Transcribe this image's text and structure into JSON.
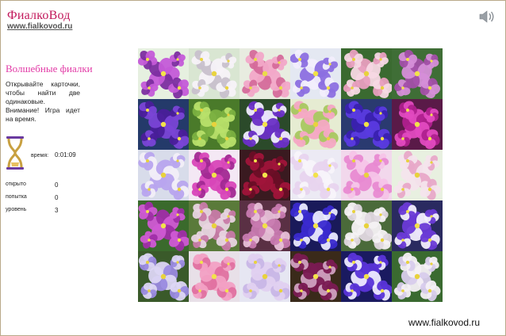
{
  "header": {
    "logo_text": "ФиалкоВод",
    "logo_url": "www.fialkovod.ru",
    "sound_icon": "speaker-icon"
  },
  "sidebar": {
    "title": "Волшебные фиалки",
    "desc_line1": "Открывайте карточки, чтобы найти две одинаковые.",
    "desc_line2": "Внимание! Игра идет на время.",
    "time_label": "время:",
    "time_value": "0:01:09",
    "stats": [
      {
        "label": "открыто",
        "value": "0"
      },
      {
        "label": "попытка",
        "value": "0"
      },
      {
        "label": "уровень",
        "value": "3"
      }
    ]
  },
  "board": {
    "rows": 5,
    "cols": 6,
    "cards": [
      {
        "bg": "#e6f0e0",
        "petal": "#c45ad8",
        "center": "#f4e44a",
        "dark": "#7c2da0"
      },
      {
        "bg": "#d9e6d2",
        "petal": "#f7f2f8",
        "center": "#e9d440",
        "dark": "#c8c0cc"
      },
      {
        "bg": "#e8ece0",
        "petal": "#f2a8c8",
        "center": "#eadc48",
        "dark": "#d56a9a"
      },
      {
        "bg": "#e4e8f2",
        "petal": "#8c6fe0",
        "center": "#f1e145",
        "dark": "#f2eefc"
      },
      {
        "bg": "#3a6a30",
        "petal": "#f7d8e4",
        "center": "#e8d23c",
        "dark": "#e89fbf"
      },
      {
        "bg": "#3f6e36",
        "petal": "#d58ed8",
        "center": "#f2e24a",
        "dark": "#a24fa8"
      },
      {
        "bg": "#243a6a",
        "petal": "#7a44d6",
        "center": "#f2e24a",
        "dark": "#4a1e9a"
      },
      {
        "bg": "#4a7a2a",
        "petal": "#b8e06a",
        "center": "#e8d23c",
        "dark": "#7ab040"
      },
      {
        "bg": "#2b4a2a",
        "petal": "#6a2fc6",
        "center": "#f4e44a",
        "dark": "#f0ecff"
      },
      {
        "bg": "#e6ecd2",
        "petal": "#f4a8c4",
        "center": "#e8d23c",
        "dark": "#a8c860"
      },
      {
        "bg": "#2a3a70",
        "petal": "#5a3ae0",
        "center": "#f1e145",
        "dark": "#3a20b0"
      },
      {
        "bg": "#5a1a48",
        "petal": "#e24ac0",
        "center": "#f2e24a",
        "dark": "#b0208e"
      },
      {
        "bg": "#d8dcea",
        "petal": "#b8a4ee",
        "center": "#e8d23c",
        "dark": "#f2eef8"
      },
      {
        "bg": "#f4e8f4",
        "petal": "#d846b8",
        "center": "#f2e24a",
        "dark": "#a22892"
      },
      {
        "bg": "#3a1a20",
        "petal": "#a0143a",
        "center": "#f4e44a",
        "dark": "#6a0e26"
      },
      {
        "bg": "#eceaf4",
        "petal": "#e8d4ee",
        "center": "#f2e24a",
        "dark": "#f8f4fa"
      },
      {
        "bg": "#f2d8ec",
        "petal": "#e88ad2",
        "center": "#e8d23c",
        "dark": "#f6c4e8"
      },
      {
        "bg": "#e8f0e0",
        "petal": "#f4e4ec",
        "center": "#e8d23c",
        "dark": "#e8a8c8"
      },
      {
        "bg": "#3a6a2c",
        "petal": "#d05ad4",
        "center": "#f2e24a",
        "dark": "#a02ea8"
      },
      {
        "bg": "#5a7a3a",
        "petal": "#e8d4e0",
        "center": "#e8d23c",
        "dark": "#c87aa8"
      },
      {
        "bg": "#5a3044",
        "petal": "#c87ab0",
        "center": "#f1e145",
        "dark": "#e8c0d8"
      },
      {
        "bg": "#1a1a5a",
        "petal": "#3a2ad0",
        "center": "#f4e44a",
        "dark": "#eaeaff"
      },
      {
        "bg": "#4a6a3a",
        "petal": "#f6f2f4",
        "center": "#e8d23c",
        "dark": "#e0d8e0"
      },
      {
        "bg": "#2a2a60",
        "petal": "#6a3ad6",
        "center": "#f2e24a",
        "dark": "#f2eefc"
      },
      {
        "bg": "#3a5a2a",
        "petal": "#dcd6f4",
        "center": "#e8d23c",
        "dark": "#9a8ae0"
      },
      {
        "bg": "#e8e0e8",
        "petal": "#f2a0c4",
        "center": "#f2e24a",
        "dark": "#e070a0"
      },
      {
        "bg": "#e6e6f2",
        "petal": "#e0d0f0",
        "center": "#e8d23c",
        "dark": "#c8b6e6"
      },
      {
        "bg": "#3a2a1a",
        "petal": "#7a1a52",
        "center": "#f4e44a",
        "dark": "#d0a0c0"
      },
      {
        "bg": "#1a1a60",
        "petal": "#5a34d8",
        "center": "#f2e24a",
        "dark": "#eeeaff"
      },
      {
        "bg": "#3a6a30",
        "petal": "#f4f0f6",
        "center": "#e8d23c",
        "dark": "#d8ccec"
      }
    ]
  },
  "footer": {
    "url": "www.fialkovod.ru"
  }
}
